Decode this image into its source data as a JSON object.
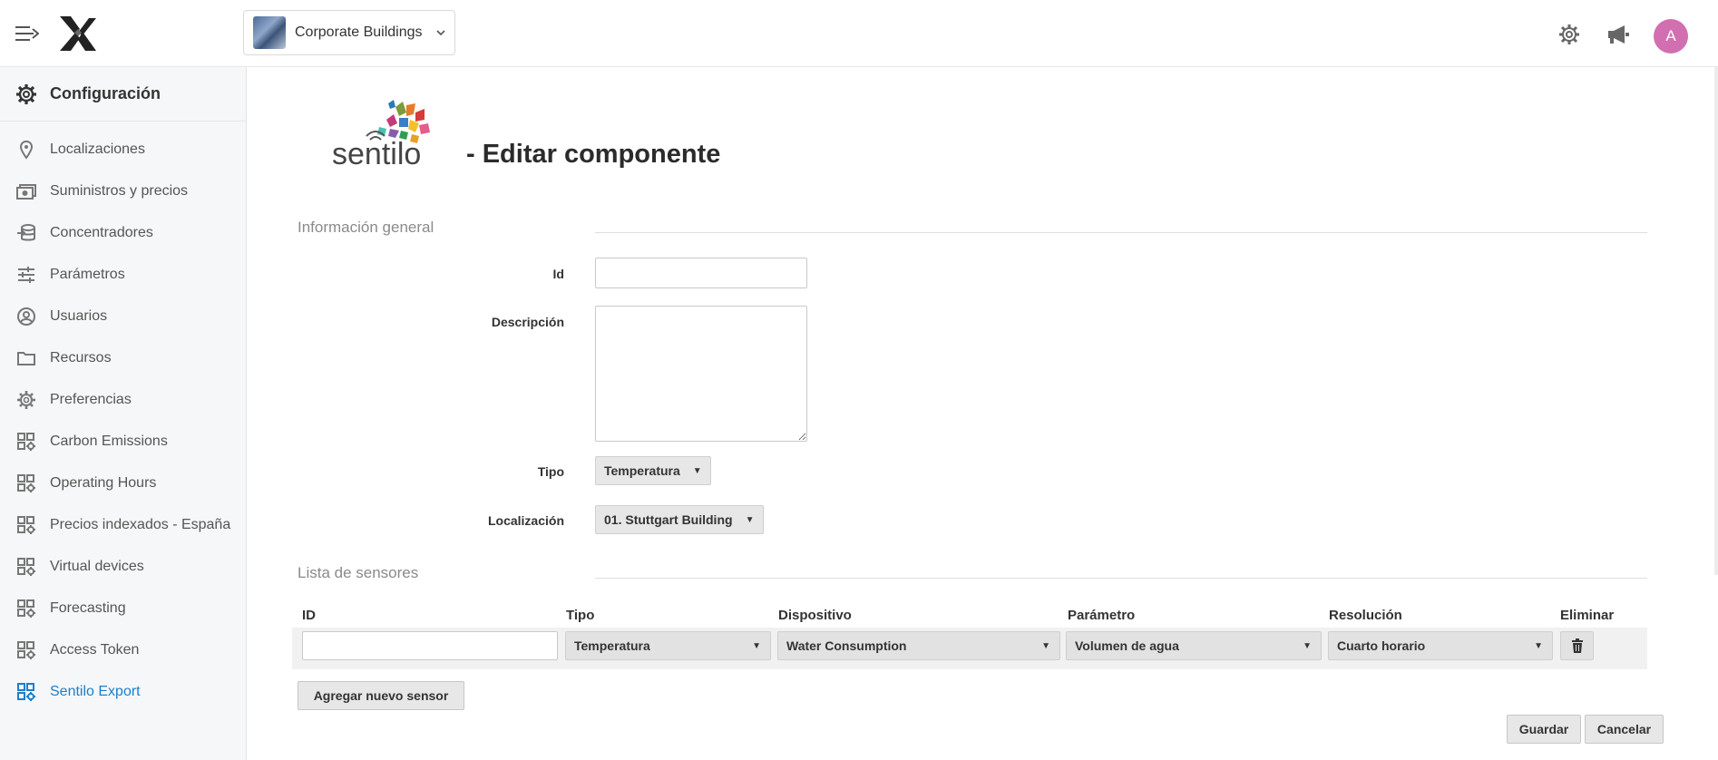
{
  "header": {
    "building": "Corporate Buildings",
    "avatar_initial": "A"
  },
  "sidebar": {
    "title": "Configuración",
    "items": [
      {
        "label": "Localizaciones",
        "icon": "location-pin-icon"
      },
      {
        "label": "Suministros y precios",
        "icon": "money-icon"
      },
      {
        "label": "Concentradores",
        "icon": "database-icon"
      },
      {
        "label": "Parámetros",
        "icon": "sliders-icon"
      },
      {
        "label": "Usuarios",
        "icon": "user-circle-icon"
      },
      {
        "label": "Recursos",
        "icon": "folder-icon"
      },
      {
        "label": "Preferencias",
        "icon": "gear-icon"
      },
      {
        "label": "Carbon Emissions",
        "icon": "widgets-gear-icon"
      },
      {
        "label": "Operating Hours",
        "icon": "widgets-gear-icon"
      },
      {
        "label": "Precios indexados - España",
        "icon": "widgets-gear-icon"
      },
      {
        "label": "Virtual devices",
        "icon": "widgets-gear-icon"
      },
      {
        "label": "Forecasting",
        "icon": "widgets-gear-icon"
      },
      {
        "label": "Access Token",
        "icon": "widgets-gear-icon"
      },
      {
        "label": "Sentilo Export",
        "icon": "widgets-gear-icon",
        "active": true
      }
    ],
    "active_color": "#1d7fcc"
  },
  "main": {
    "logo_text": "sentilo",
    "title": "- Editar componente",
    "general_section": "Información general",
    "id_label": "Id",
    "id_value": "",
    "description_label": "Descripción",
    "description_value": "",
    "type_label": "Tipo",
    "type_value": "Temperatura",
    "location_label": "Localización",
    "location_value": "01. Stuttgart Building",
    "sensors_section": "Lista de sensores",
    "columns": {
      "id": "ID",
      "type": "Tipo",
      "device": "Dispositivo",
      "parameter": "Parámetro",
      "resolution": "Resolución",
      "delete": "Eliminar"
    },
    "sensor_row": {
      "id": "",
      "type": "Temperatura",
      "device": "Water Consumption",
      "parameter": "Volumen de agua",
      "resolution": "Cuarto horario"
    },
    "add_sensor": "Agregar nuevo sensor",
    "save": "Guardar",
    "cancel": "Cancelar"
  }
}
